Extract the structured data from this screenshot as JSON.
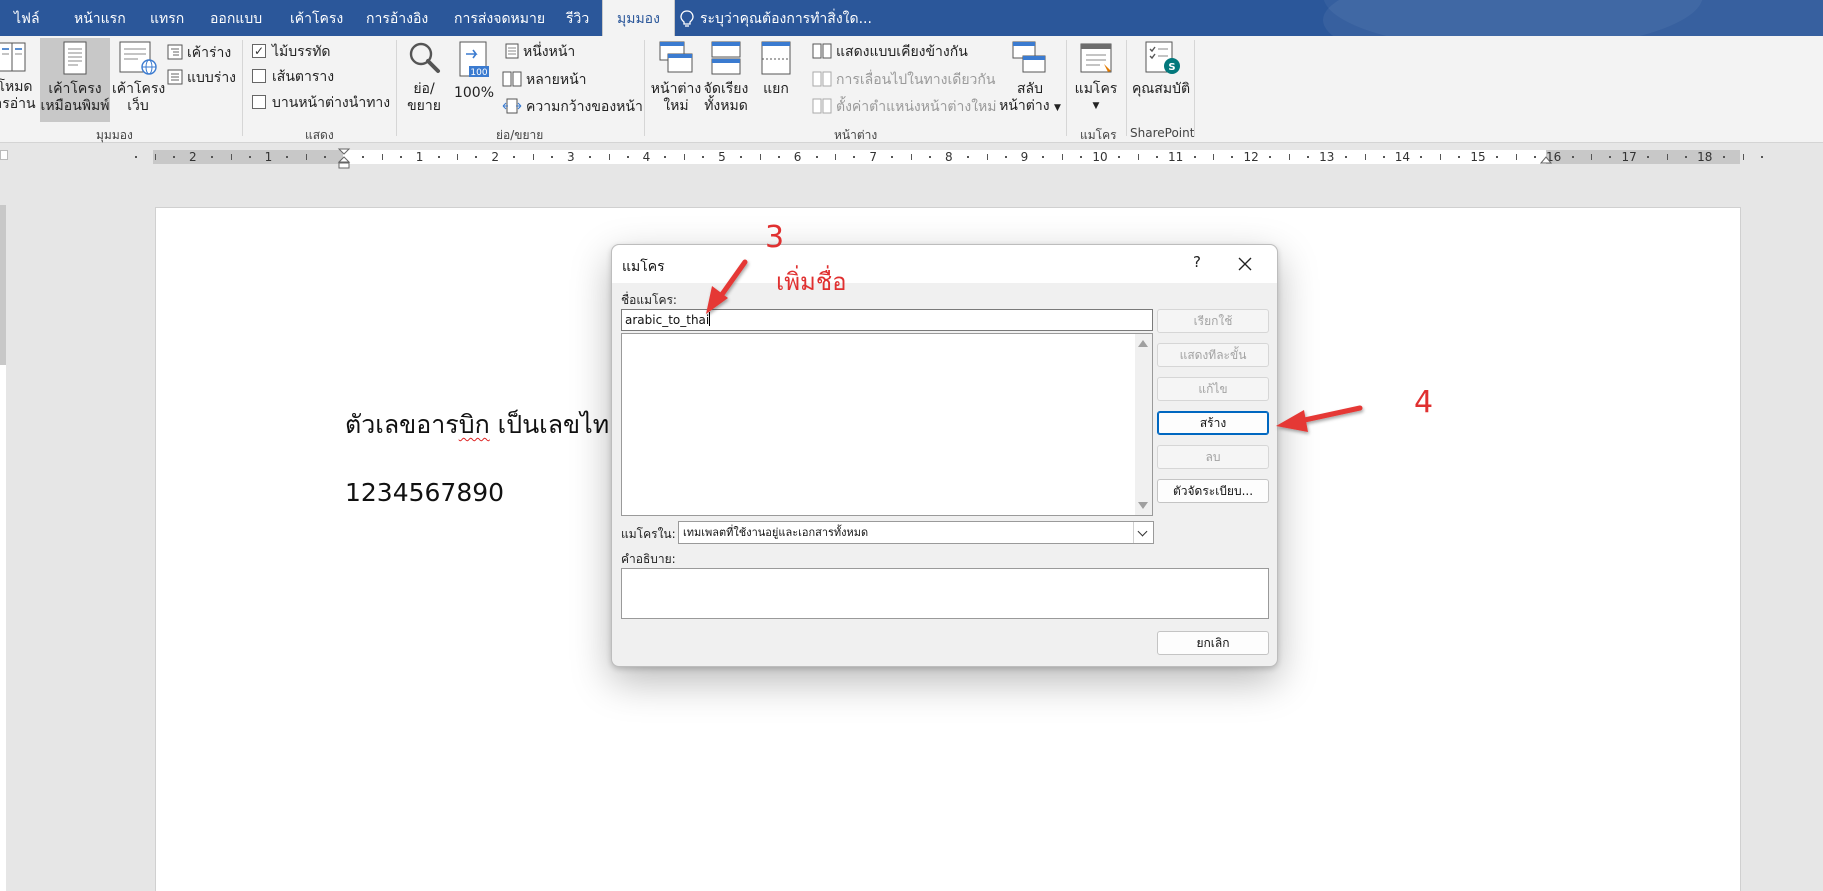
{
  "tabs": [
    {
      "label": "ไฟล์"
    },
    {
      "label": "หน้าแรก"
    },
    {
      "label": "แทรก"
    },
    {
      "label": "ออกแบบ"
    },
    {
      "label": "เค้าโครง"
    },
    {
      "label": "การอ้างอิง"
    },
    {
      "label": "การส่งจดหมาย"
    },
    {
      "label": "รีวิว"
    },
    {
      "label": "มุมมอง"
    }
  ],
  "tell_me": "ระบุว่าคุณต้องการทำสิ่งใด...",
  "ribbon": {
    "views": {
      "read_mode_1": "โหมด",
      "read_mode_2": "ารอ่าน",
      "print_layout_1": "เค้าโครง",
      "print_layout_2": "เหมือนพิมพ์",
      "web_layout_1": "เค้าโครง",
      "web_layout_2": "เว็บ",
      "outline": "เค้าร่าง",
      "draft": "แบบร่าง",
      "group": "มุมมอง"
    },
    "show": {
      "ruler": "ไม้บรรทัด",
      "gridlines": "เส้นตาราง",
      "nav_pane": "บานหน้าต่างนำทาง",
      "group": "แสดง"
    },
    "zoom": {
      "zoom_1": "ย่อ/",
      "zoom_2": "ขยาย",
      "percent": "100%",
      "icon_badge": "100",
      "one_page": "หนึ่งหน้า",
      "multiple_pages": "หลายหน้า",
      "page_width": "ความกว้างของหน้า",
      "group": "ย่อ/ขยาย"
    },
    "window": {
      "new_window_1": "หน้าต่าง",
      "new_window_2": "ใหม่",
      "arrange_all_1": "จัดเรียง",
      "arrange_all_2": "ทั้งหมด",
      "split": "แยก",
      "side_by_side": "แสดงแบบเคียงข้างกัน",
      "sync_scroll": "การเลื่อนไปในทางเดียวกัน",
      "reset_position": "ตั้งค่าตำแหน่งหน้าต่างใหม่",
      "switch_1": "สลับ",
      "switch_2": "หน้าต่าง",
      "group": "หน้าต่าง"
    },
    "macros": {
      "label": "แมโคร",
      "group": "แมโคร"
    },
    "sharepoint": {
      "label": "คุณสมบัติ",
      "group": "SharePoint"
    }
  },
  "ruler": {
    "left_numbers": [
      "2",
      "1"
    ],
    "right_numbers": [
      "1",
      "2",
      "3",
      "4",
      "5",
      "6",
      "7",
      "8",
      "9",
      "10",
      "11",
      "12",
      "13",
      "14",
      "15",
      "16",
      "17",
      "18"
    ]
  },
  "document": {
    "line1_before": "ตัวเลขอาร",
    "line1_squiggle": "บิก",
    "line1_after": " เป็นเลขไทย",
    "line2": "1234567890"
  },
  "dialog": {
    "title": "แมโคร",
    "help": "?",
    "macro_name_label": "ชื่อแมโคร:",
    "macro_name_value": "arabic_to_thai",
    "macros_in_label": "แมโครใน:",
    "macros_in_value": "เทมเพลตที่ใช้งานอยู่และเอกสารทั้งหมด",
    "description_label": "คำอธิบาย:",
    "buttons": {
      "run": "เรียกใช้",
      "step_into": "แสดงทีละขั้น",
      "edit": "แก้ไข",
      "create": "สร้าง",
      "delete": "ลบ",
      "organizer": "ตัวจัดระเบียบ...",
      "cancel": "ยกเลิก"
    }
  },
  "annotations": {
    "step3": "3",
    "step3_text": "เพิ่มชื่อ",
    "step4": "4",
    "color": "#e03030"
  }
}
